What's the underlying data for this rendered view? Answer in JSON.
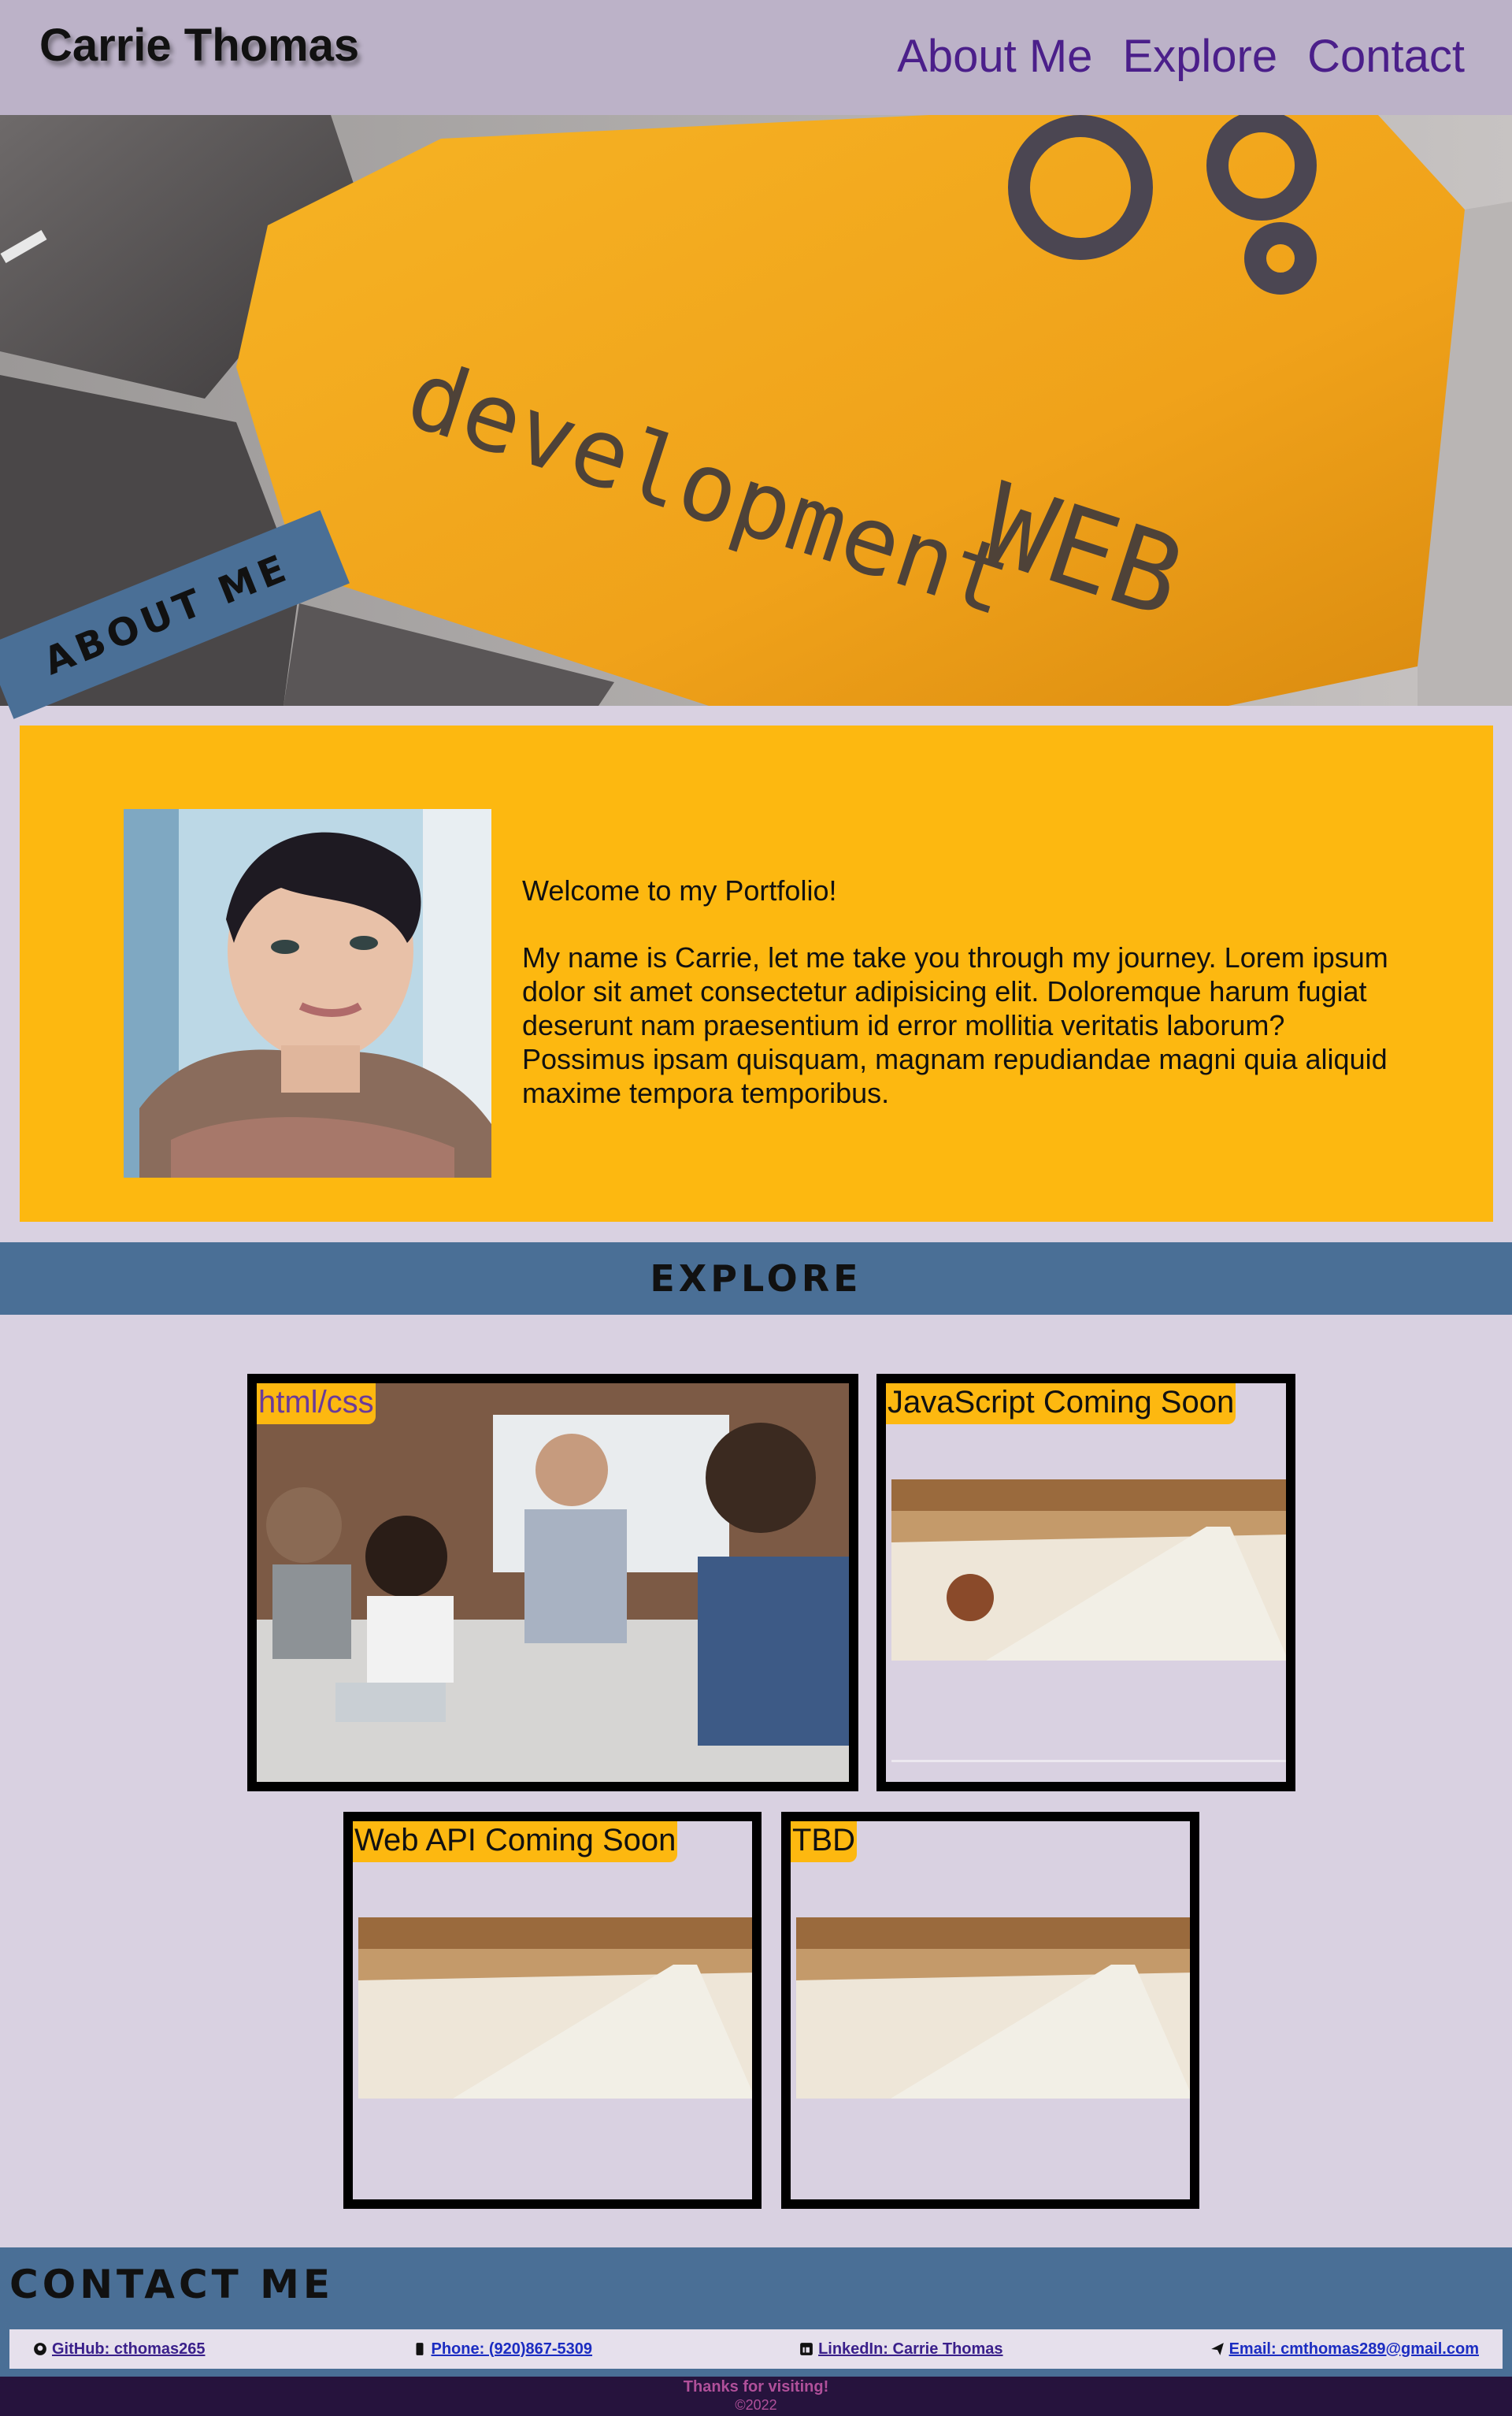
{
  "header": {
    "title": "Carrie Thomas",
    "nav": [
      "About Me",
      "Explore",
      "Contact"
    ]
  },
  "hero": {
    "key_text_1": "development",
    "key_text_2": "WEB"
  },
  "about": {
    "tag": "ABOUT ME",
    "welcome": "Welcome to my Portfolio!",
    "body": "My name is Carrie, let me take you through my journey. Lorem ipsum dolor sit amet consectetur adipisicing elit. Doloremque harum fugiat deserunt nam praesentium id error mollitia veritatis laborum? Possimus ipsam quisquam, magnam repudiandae magni quia aliquid maxime tempora temporibus."
  },
  "explore": {
    "title": "EXPLORE",
    "cards": [
      {
        "label": "html/css"
      },
      {
        "label": "JavaScript Coming Soon"
      },
      {
        "label": "Web API Coming Soon"
      },
      {
        "label": "TBD"
      }
    ]
  },
  "contact": {
    "title": "CONTACT ME",
    "links": [
      {
        "label": "GitHub: cthomas265",
        "icon": "github-icon"
      },
      {
        "label": "Phone: (920)867-5309",
        "icon": "phone-icon"
      },
      {
        "label": "LinkedIn: Carrie Thomas",
        "icon": "linkedin-icon"
      },
      {
        "label": "Email: cmthomas289@gmail.com",
        "icon": "paper-plane-icon"
      }
    ]
  },
  "footer": {
    "thanks": "Thanks for visiting!",
    "copyright": "©2022"
  },
  "colors": {
    "header_bg": "#bcb2c8",
    "nav_text": "#4b1f8a",
    "accent_yellow": "#fdb810",
    "section_blue": "#4a6f96",
    "page_bg": "#d9d1e1",
    "footer_bg": "#26133d"
  }
}
